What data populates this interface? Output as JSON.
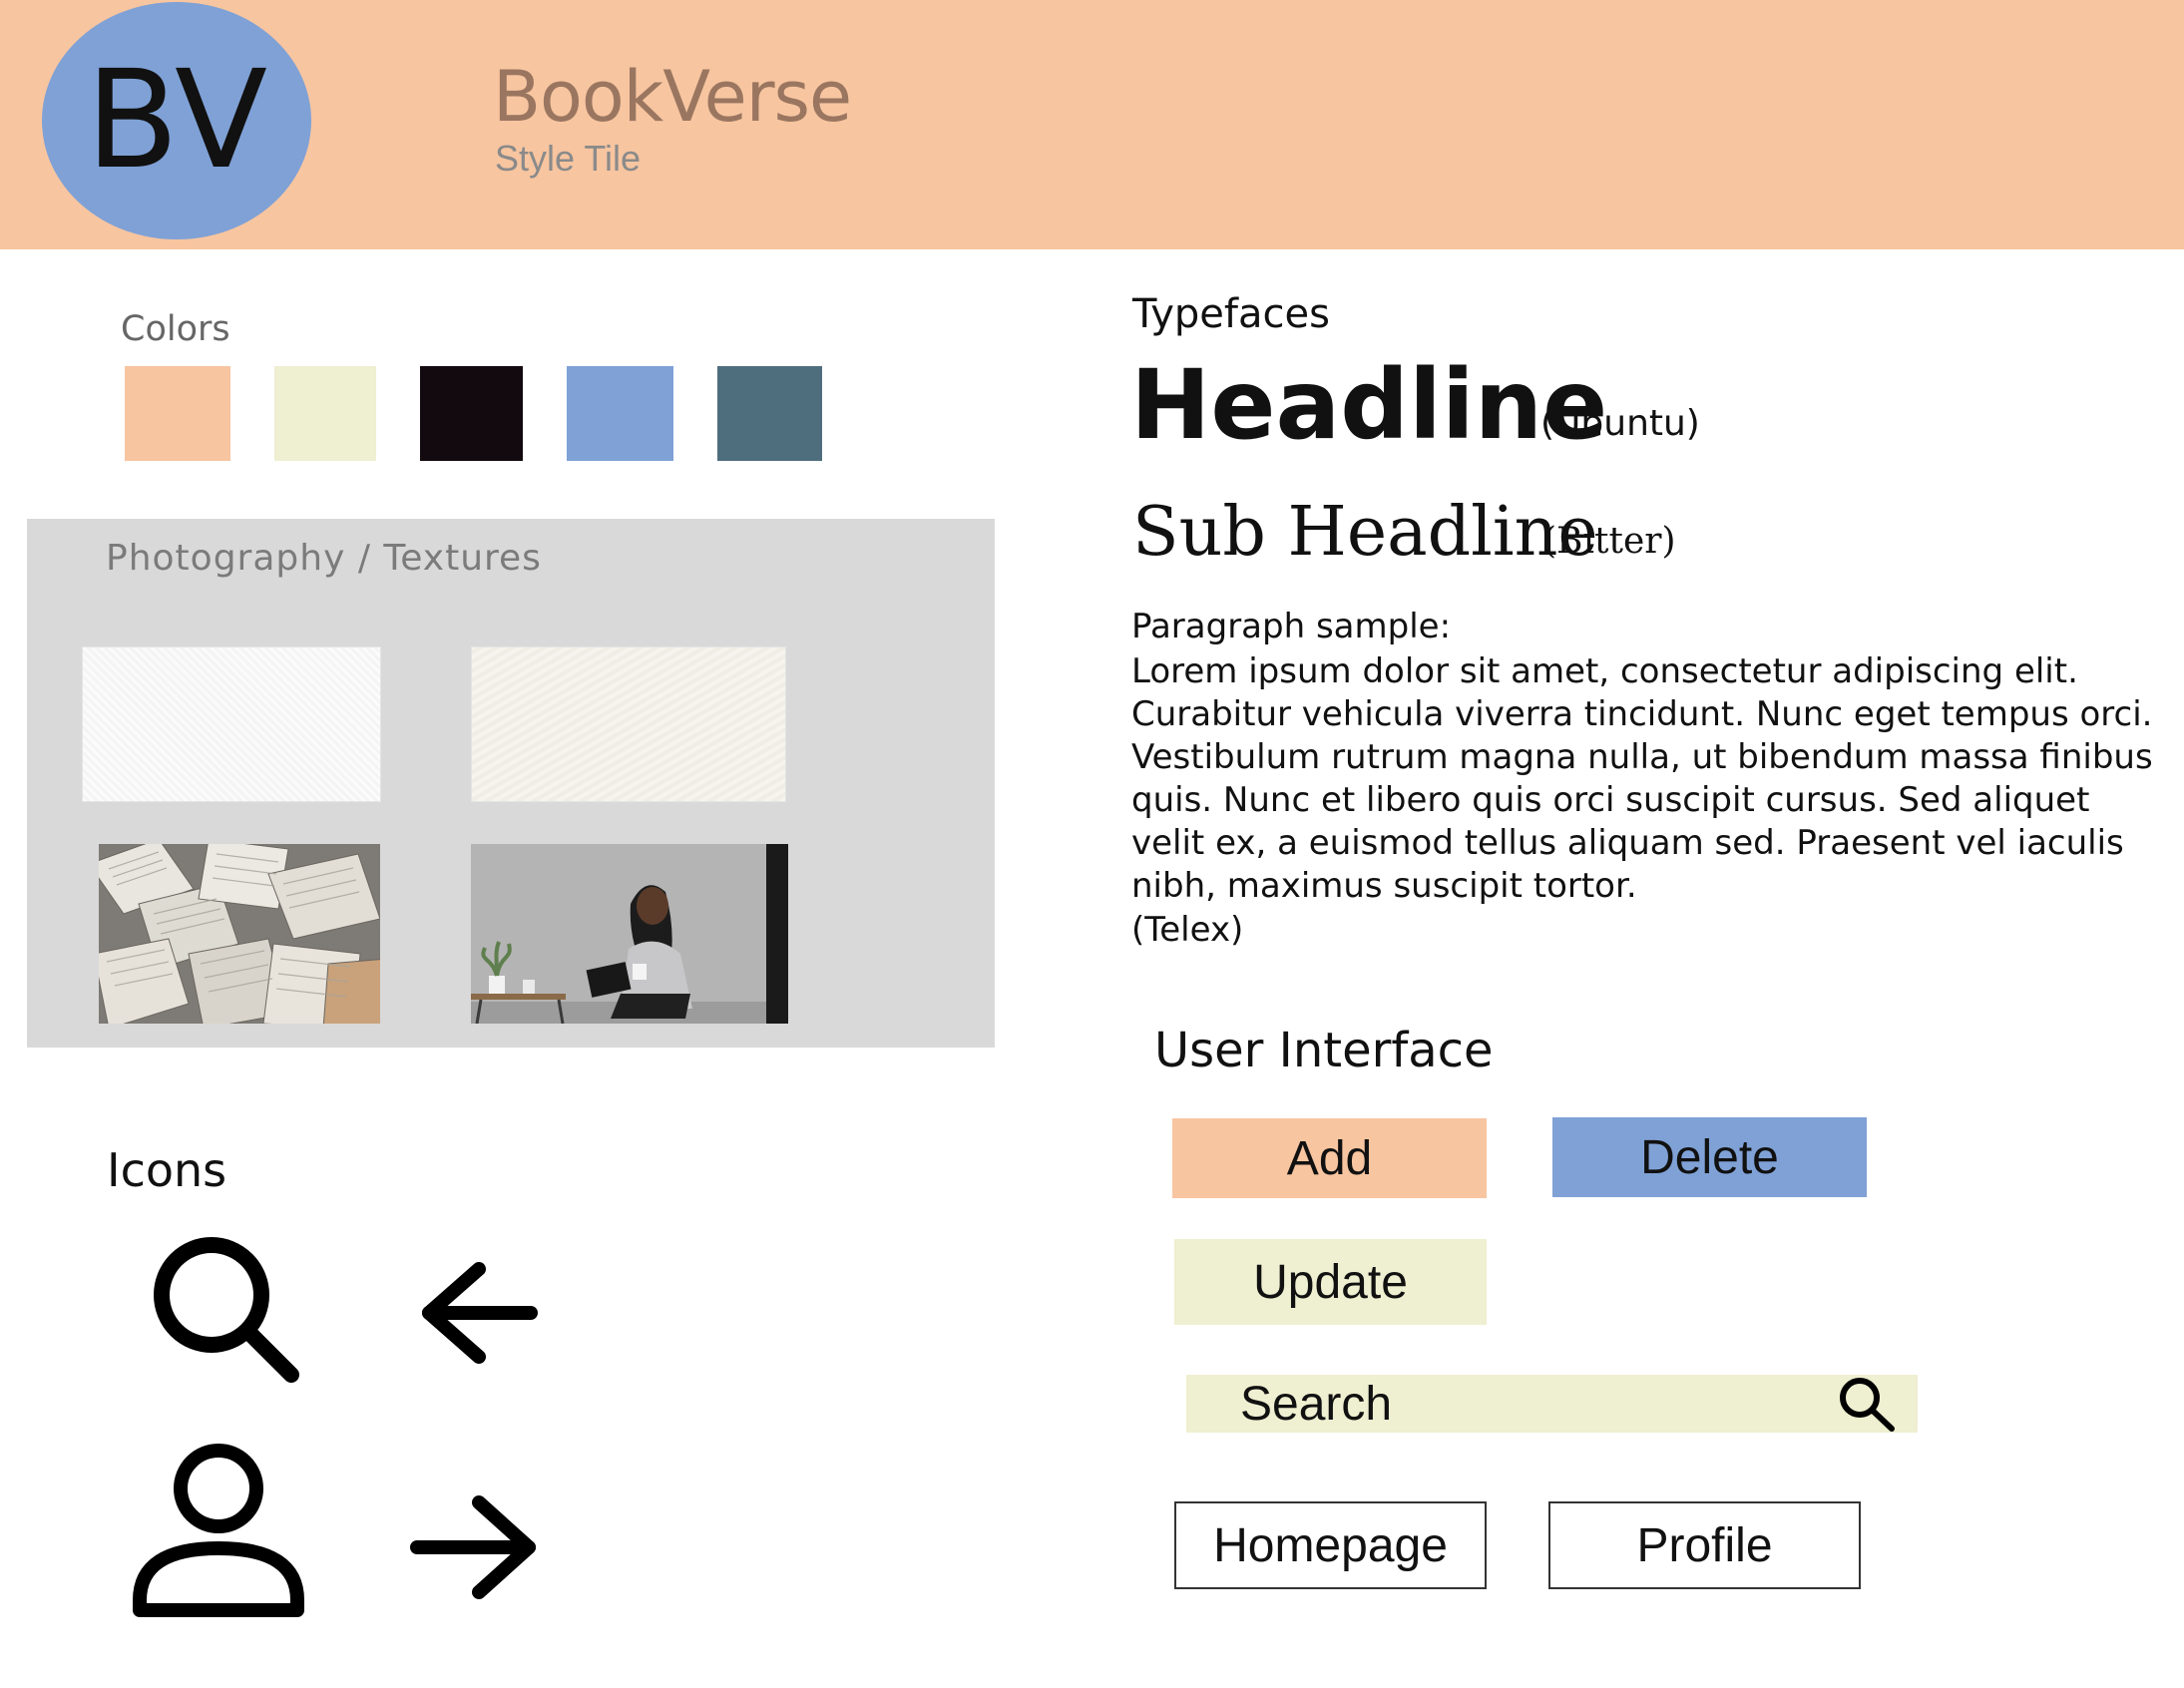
{
  "header": {
    "logo_text": "BV",
    "title": "BookVerse",
    "subtitle": "Style Tile"
  },
  "colors": {
    "label": "Colors",
    "swatches": [
      "#f7c5a0",
      "#efefd1",
      "#130a10",
      "#7fa1d6",
      "#4f6e7d"
    ]
  },
  "photography": {
    "label": "Photography / Textures"
  },
  "icons": {
    "label": "Icons",
    "items": [
      "search-icon",
      "arrow-left-icon",
      "user-icon",
      "arrow-right-icon"
    ]
  },
  "typefaces": {
    "label": "Typefaces",
    "headline": "Headline",
    "headline_font": "(Ubuntu)",
    "subheadline": "Sub Headline",
    "subheadline_font": "(Bitter)",
    "paragraph_label": "Paragraph sample:",
    "paragraph": "Lorem ipsum dolor sit amet, consectetur adipiscing elit. Curabitur vehicula viverra tincidunt. Nunc eget tempus orci. Vestibulum rutrum magna nulla, ut bibendum massa finibus quis. Nunc et libero quis orci suscipit cursus. Sed aliquet velit ex, a euismod tellus aliquam sed. Praesent vel iaculis nibh, maximus suscipit tortor.",
    "paragraph_font": "(Telex)"
  },
  "ui": {
    "label": "User Interface",
    "add": "Add",
    "delete": "Delete",
    "update": "Update",
    "search_placeholder": "Search",
    "homepage": "Homepage",
    "profile": "Profile"
  }
}
